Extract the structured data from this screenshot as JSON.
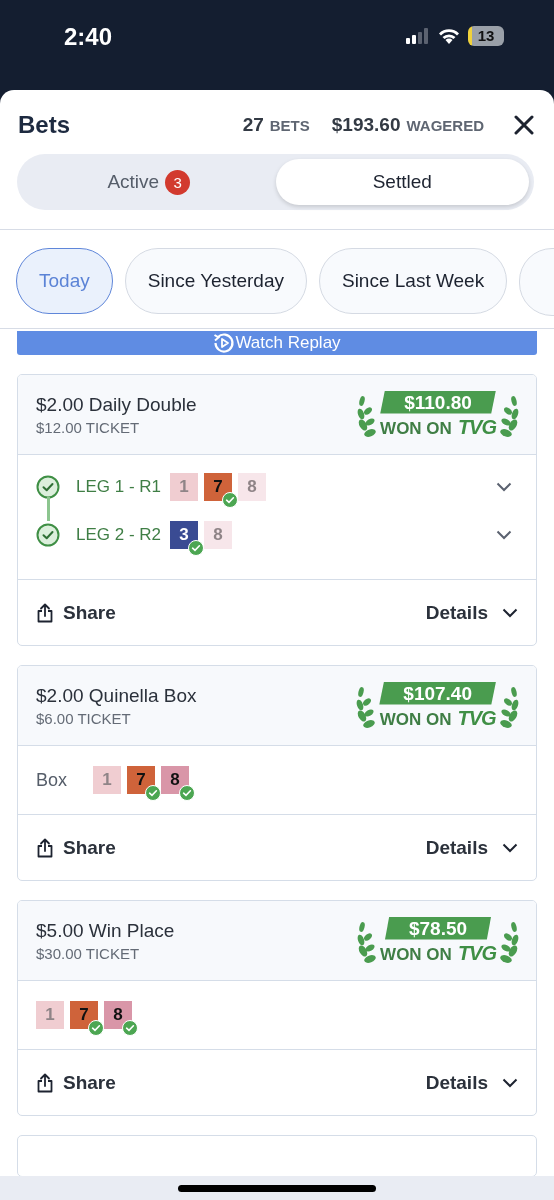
{
  "status_bar": {
    "time": "2:40",
    "battery": "13"
  },
  "header": {
    "title": "Bets",
    "bets_count": "27",
    "bets_label": "BETS",
    "wagered_amount": "$193.60",
    "wagered_label": "WAGERED"
  },
  "tabs": [
    {
      "label": "Active",
      "badge": "3",
      "selected": false
    },
    {
      "label": "Settled",
      "selected": true
    }
  ],
  "filters": [
    {
      "label": "Today",
      "selected": true
    },
    {
      "label": "Since Yesterday",
      "selected": false
    },
    {
      "label": "Since Last Week",
      "selected": false
    }
  ],
  "replay_button": "Watch Replay",
  "bets": [
    {
      "title": "$2.00 Daily Double",
      "ticket": "$12.00 TICKET",
      "payout": "$110.80",
      "won_label": "WON ON",
      "brand": "TVG",
      "kind": "legs",
      "legs": [
        {
          "label": "LEG 1 - R1",
          "won": true,
          "runners": [
            {
              "number": "1",
              "color": "#f0cdd1",
              "faded": true,
              "won": false
            },
            {
              "number": "7",
              "color": "#cf633a",
              "faded": false,
              "won": true
            },
            {
              "number": "8",
              "color": "#f7e6ea",
              "faded": true,
              "won": false
            }
          ]
        },
        {
          "label": "LEG 2 - R2",
          "won": true,
          "runners": [
            {
              "number": "3",
              "color": "#3a4b93",
              "faded": false,
              "won": true
            },
            {
              "number": "8",
              "color": "#f7e6ea",
              "faded": true,
              "won": false
            }
          ]
        }
      ],
      "share": "Share",
      "details": "Details"
    },
    {
      "title": "$2.00 Quinella Box",
      "ticket": "$6.00 TICKET",
      "payout": "$107.40",
      "won_label": "WON ON",
      "brand": "TVG",
      "kind": "selection",
      "label": "Box",
      "runners": [
        {
          "number": "1",
          "color": "#f0cdd1",
          "faded": true,
          "won": false
        },
        {
          "number": "7",
          "color": "#cf633a",
          "faded": false,
          "won": true
        },
        {
          "number": "8",
          "color": "#d996a8",
          "faded": false,
          "won": true
        }
      ],
      "share": "Share",
      "details": "Details"
    },
    {
      "title": "$5.00 Win Place",
      "ticket": "$30.00 TICKET",
      "payout": "$78.50",
      "won_label": "WON ON",
      "brand": "TVG",
      "kind": "selection",
      "runners": [
        {
          "number": "1",
          "color": "#f0cdd1",
          "faded": true,
          "won": false
        },
        {
          "number": "7",
          "color": "#cf633a",
          "faded": false,
          "won": true
        },
        {
          "number": "8",
          "color": "#d996a8",
          "faded": false,
          "won": true
        }
      ],
      "share": "Share",
      "details": "Details"
    }
  ]
}
